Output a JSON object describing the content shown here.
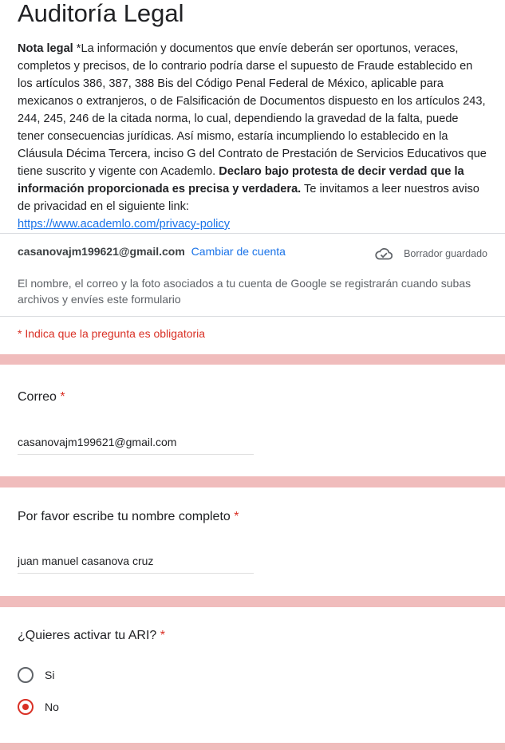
{
  "header": {
    "title": "Auditoría Legal",
    "legal_label": "Nota legal",
    "legal_text_1": " *La información y documentos que envíe deberán ser oportunos, veraces, completos y precisos, de lo contrario podría darse el supuesto de Fraude establecido en los artículos 386, 387, 388 Bis del Código Penal Federal de México, aplicable para mexicanos o extranjeros, o de Falsificación de Documentos dispuesto en los artículos 243, 244, 245, 246 de la citada norma, lo cual, dependiendo la gravedad de la falta, puede tener consecuencias jurídicas. Así mismo, estaría incumpliendo lo establecido en la Cláusula Décima Tercera, inciso G del Contrato de Prestación de Servicios Educativos que tiene suscrito y vigente con Academlo. ",
    "legal_bold": "Declaro bajo protesta de decir verdad que la información proporcionada es precisa y verdadera.",
    "legal_text_2": " Te invitamos a leer nuestros aviso de privacidad en el siguiente link:",
    "privacy_link": "https://www.academlo.com/privacy-policy"
  },
  "account": {
    "email": "casanovajm199621@gmail.com",
    "switch_label": "Cambiar de cuenta",
    "saved_status": "Borrador guardado",
    "notice": "El nombre, el correo y la foto asociados a tu cuenta de Google se registrarán cuando subas archivos y envíes este formulario",
    "required_note": "* Indica que la pregunta es obligatoria"
  },
  "questions": {
    "email": {
      "label": "Correo",
      "required_mark": "*",
      "value": "casanovajm199621@gmail.com"
    },
    "name": {
      "label": "Por favor escribe tu nombre completo",
      "required_mark": "*",
      "value": "juan manuel casanova cruz"
    },
    "ari": {
      "label": "¿Quieres activar tu ARI?",
      "required_mark": "*",
      "options": [
        "Si",
        "No"
      ],
      "selected": "No"
    }
  },
  "colors": {
    "accent": "#d93025",
    "link": "#1a73e8",
    "background": "#f0bcbc"
  },
  "icons": {
    "saved": "cloud-check-icon"
  }
}
